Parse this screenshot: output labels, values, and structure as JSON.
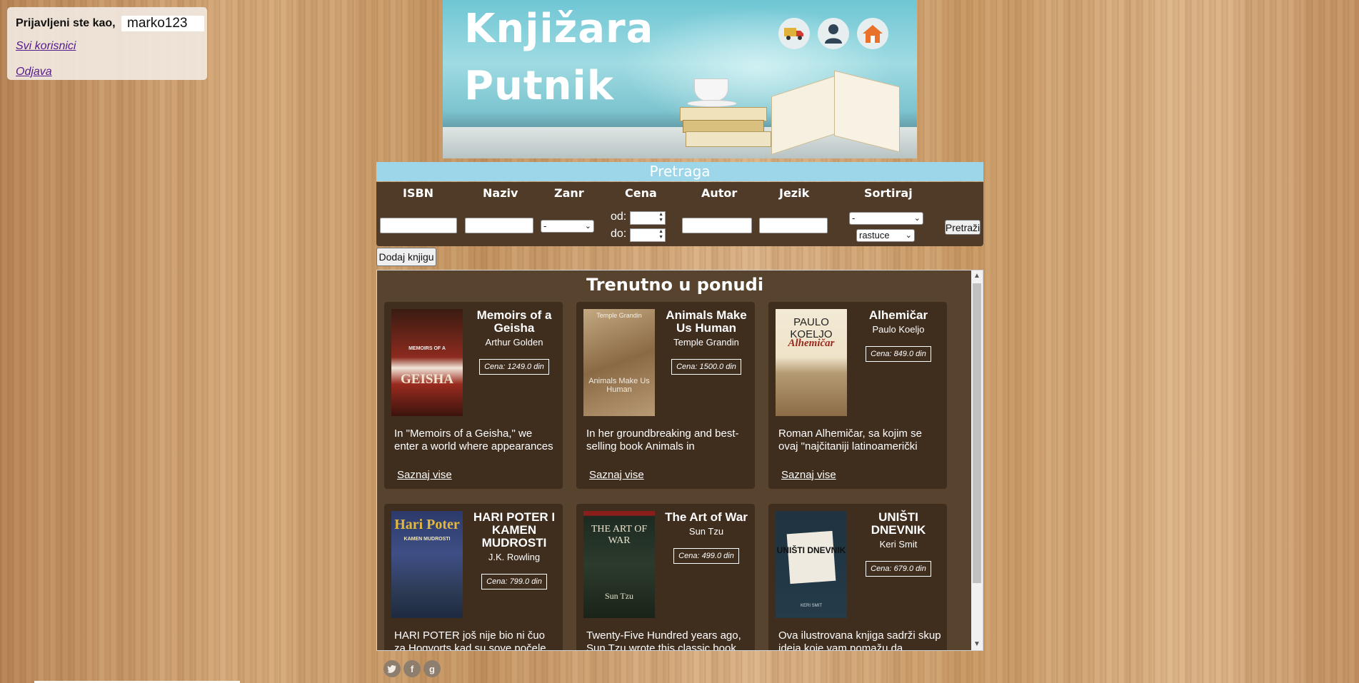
{
  "login": {
    "prefix": "Prijavljeni ste kao,",
    "username": "marko123",
    "all_users": "Svi korisnici",
    "logout": "Odjava"
  },
  "banner": {
    "title_line1": "Knjižara",
    "title_line2": "Putnik",
    "icons": [
      "delivery-truck-icon",
      "user-icon",
      "home-icon"
    ]
  },
  "search": {
    "header": "Pretraga",
    "labels": {
      "isbn": "ISBN",
      "naziv": "Naziv",
      "zanr": "Zanr",
      "cena": "Cena",
      "autor": "Autor",
      "jezik": "Jezik",
      "sortiraj": "Sortiraj"
    },
    "zanr_selected": "-",
    "cena_from_label": "od:",
    "cena_to_label": "do:",
    "sort_field_selected": "-",
    "sort_order_selected": "rastuce",
    "search_button": "Pretraži"
  },
  "add_book_button": "Dodaj knjigu",
  "offer": {
    "title": "Trenutno u ponudi",
    "link_label": "Saznaj vise",
    "books": [
      {
        "title": "Memoirs of a Geisha",
        "author": "Arthur Golden",
        "price": "Cena: 1249.0 din",
        "desc": "In \"Memoirs of a Geisha,\" we enter a world where appearances",
        "cover_text": "GEISHA",
        "cover_top": "MEMOIRS OF A"
      },
      {
        "title": "Animals Make Us Human",
        "author": "Temple Grandin",
        "price": "Cena: 1500.0 din",
        "desc": "In her groundbreaking and best-selling book Animals in",
        "cover_text": "Animals Make Us Human",
        "cover_top": "Temple Grandin"
      },
      {
        "title": "Alhemičar",
        "author": "Paulo Koeljo",
        "price": "Cena: 849.0 din",
        "desc": "Roman Alhemičar, sa kojim se ovaj \"najčitaniji latinoamerički",
        "cover_text": "Alhemičar",
        "cover_top": "PAULO KOELJO"
      },
      {
        "title": "HARI POTER I KAMEN MUDROSTI",
        "author": "J.K. Rowling",
        "price": "Cena: 799.0 din",
        "desc": "HARI POTER još nije bio ni čuo za Hogvorts kad su sove počele",
        "cover_text": "Hari Poter",
        "cover_top": "KAMEN MUDROSTI"
      },
      {
        "title": "The Art of War",
        "author": "Sun Tzu",
        "price": "Cena: 499.0 din",
        "desc": "Twenty-Five Hundred years ago, Sun Tzu wrote this classic book",
        "cover_text": "THE ART OF WAR",
        "cover_top": "Sun Tzu"
      },
      {
        "title": "UNIŠTI DNEVNIK",
        "author": "Keri Smit",
        "price": "Cena: 679.0 din",
        "desc": "Ova ilustrovana knjiga sadrži skup ideja koje vam pomažu da",
        "cover_text": "UNIŠTI DNEVNIK",
        "cover_top": "KERI SMIT"
      }
    ]
  },
  "social": {
    "twitter": "twitter-icon",
    "facebook": "facebook-icon",
    "google": "google-plus-icon",
    "facebook_glyph": "f",
    "google_glyph": "g"
  }
}
